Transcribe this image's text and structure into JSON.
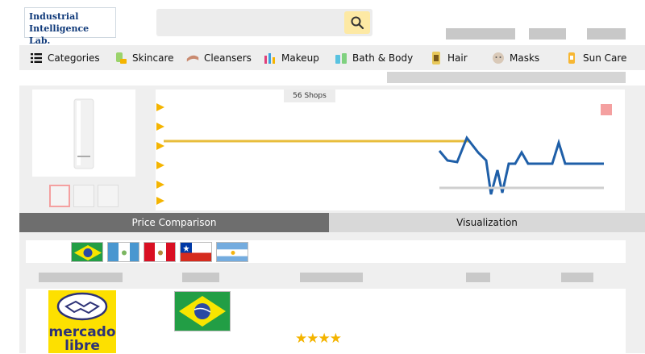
{
  "header": {
    "logo_line1": "Industrial",
    "logo_line2": "Intelligence Lab.",
    "search": {
      "placeholder": ""
    }
  },
  "nav": {
    "items": [
      {
        "label": "Categories",
        "icon": "menu-icon"
      },
      {
        "label": "Skincare",
        "icon": "skincare-icon"
      },
      {
        "label": "Cleansers",
        "icon": "cleansers-icon"
      },
      {
        "label": "Makeup",
        "icon": "makeup-icon"
      },
      {
        "label": "Bath & Body",
        "icon": "bath-body-icon"
      },
      {
        "label": "Hair",
        "icon": "hair-icon"
      },
      {
        "label": "Masks",
        "icon": "masks-icon"
      },
      {
        "label": "Sun Care",
        "icon": "sun-care-icon"
      }
    ]
  },
  "product": {
    "shops_badge": "56 Shops"
  },
  "tabs": {
    "price_comparison": "Price Comparison",
    "visualization": "Visualization"
  },
  "countries": [
    "Brazil",
    "Guatemala",
    "Peru",
    "Chile",
    "Argentina"
  ],
  "listing": {
    "store_logo_line1": "mercado",
    "store_logo_line2": "libre",
    "rating_stars": "★★★★"
  },
  "colors": {
    "accent": "#f4b400",
    "line_chart": "#1f5fa8",
    "tab_active": "#6e6e6e",
    "mercado_yellow": "#fde000"
  }
}
